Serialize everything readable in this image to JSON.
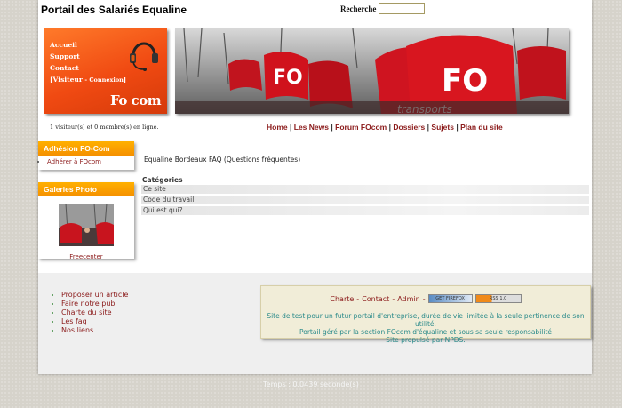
{
  "header": {
    "site_title": "Portail des Salariés Equaline",
    "search_label": "Recherche",
    "search_value": ""
  },
  "logo": {
    "menu": [
      "Accueil",
      "Support",
      "Contact"
    ],
    "visitor_prefix": "[Visiteur",
    "visitor_suffix": "- Connexion]",
    "brand": "Fo com"
  },
  "status": {
    "online_text": "1 visiteur(s) et 0 membre(s) en ligne."
  },
  "topnav": {
    "items": [
      "Home",
      "Les News",
      "Forum FOcom",
      "Dossiers",
      "Sujets",
      "Plan du site"
    ],
    "separator": "|"
  },
  "sidebar": {
    "adhesion": {
      "title": "Adhésion FO-Com",
      "items": [
        "Adhérer à FOcom"
      ]
    },
    "galleries": {
      "title": "Galeries Photo",
      "caption": "Freecenter"
    }
  },
  "main": {
    "faq_title": "Equaline Bordeaux FAQ (Questions fréquentes)",
    "categories_title": "Catégories",
    "categories": [
      "Ce site",
      "Code du travail",
      "Qui est qui?"
    ]
  },
  "footer": {
    "links": [
      "Proposer un article",
      "Faire notre pub",
      "Charte du site",
      "Les faq",
      "Nos liens"
    ],
    "credits": [
      "Charte",
      "Contact",
      "Admin"
    ],
    "credit_separator": "-",
    "badge_firefox": "GET FIREFOX",
    "badge_rss": "RSS 1.0",
    "info_lines": [
      "Site de test pour un futur portail d'entreprise, durée de vie limitée à la seule pertinence de son utilité.",
      "Portail géré par la section FOcom d'équaline et sous sa seule responsabilité",
      "Site propulsé par NPDS."
    ],
    "timer": "Temps : 0.0439 seconde(s)"
  },
  "colors": {
    "accent_orange": "#f59000",
    "logo_red": "#f04a12",
    "link_maroon": "#8b1a1a",
    "info_teal": "#2a8a8a"
  }
}
